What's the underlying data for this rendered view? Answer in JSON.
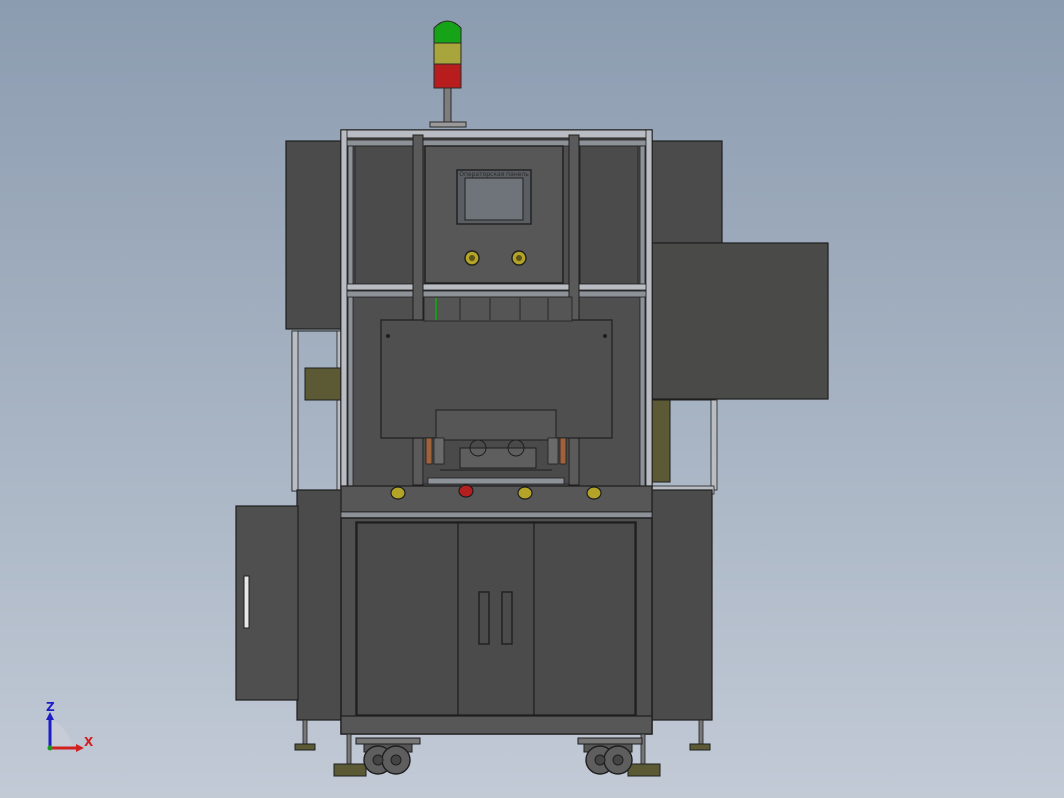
{
  "viewport": {
    "background_top": "#8c9cb0",
    "background_bottom": "#c2cad6"
  },
  "colors": {
    "body": "#4b4b4b",
    "body_light": "#575757",
    "panel_side_right": "#4a4a48",
    "frame_edge": "#1e1e1e",
    "frame_highlight": "#b9bdc3",
    "screen": "#6f747a",
    "screen_border": "#2c2c2c",
    "signal_green": "#17a317",
    "signal_yellow": "#a8a53c",
    "signal_red": "#b81d1d",
    "button_yellow": "#b3a428",
    "button_red": "#b31e1e",
    "copper": "#a0623c",
    "olive_panel": "#5b5a35",
    "axis_x": "#d02020",
    "axis_y": "#1a9a1a",
    "axis_z": "#1d1dc8"
  },
  "machine": {
    "signal_tower": {
      "icon": "signal-tower-icon",
      "lights": [
        "green",
        "yellow",
        "red"
      ]
    },
    "control_screen": {
      "icon": "hmi-touchscreen-icon",
      "label": "Операторская панель"
    },
    "control_knobs": 2,
    "operator_buttons": [
      "yellow",
      "red",
      "yellow",
      "yellow"
    ],
    "cabinet_doors": 3,
    "door_handles": 2,
    "casters": 2,
    "leveling_feet": 4
  },
  "axis_triad": {
    "icon": "coordinate-triad-icon",
    "z_label": "Z",
    "x_label": "X"
  }
}
